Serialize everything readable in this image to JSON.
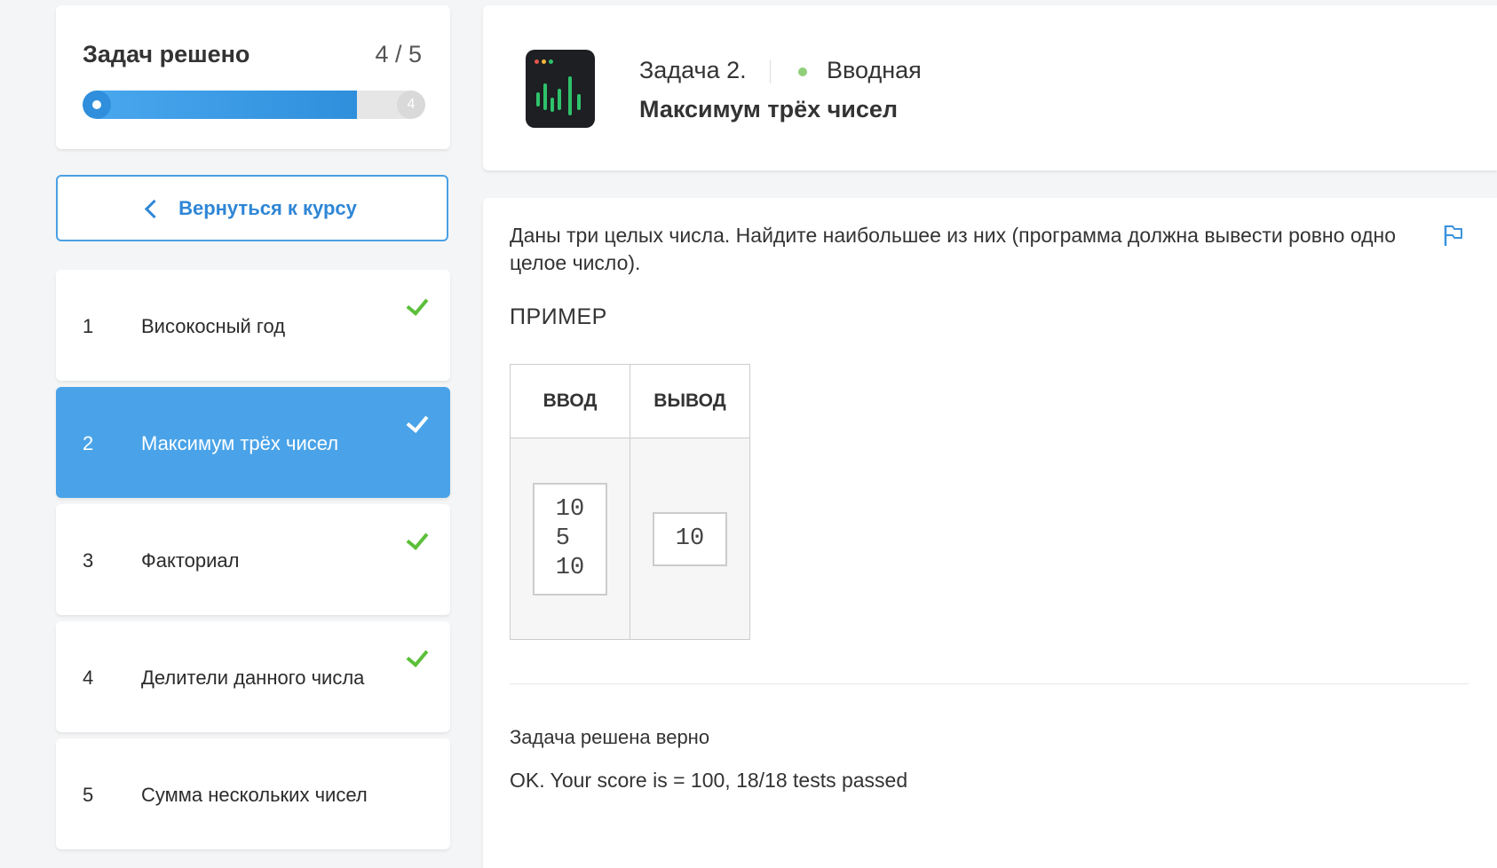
{
  "progress": {
    "title": "Задач решено",
    "count": "4 / 5",
    "solved": 4,
    "total": 5,
    "end_marker": "4"
  },
  "back_button": {
    "label": "Вернуться к курсу"
  },
  "tasks": [
    {
      "num": "1",
      "label": "Високосный год",
      "solved": true,
      "active": false
    },
    {
      "num": "2",
      "label": "Максимум трёх чисел",
      "solved": true,
      "active": true
    },
    {
      "num": "3",
      "label": "Факториал",
      "solved": true,
      "active": false
    },
    {
      "num": "4",
      "label": "Делители данного числа",
      "solved": true,
      "active": false
    },
    {
      "num": "5",
      "label": "Сумма нескольких чисел",
      "solved": false,
      "active": false
    }
  ],
  "header": {
    "task_number": "Задача 2.",
    "level": "Вводная",
    "title": "Максимум трёх чисел",
    "icon": "terminal-chart-icon"
  },
  "content": {
    "statement": "Даны три целых числа. Найдите наибольшее из них (программа должна вывести ровно одно целое число).",
    "example_heading": "ПРИМЕР",
    "table": {
      "input_header": "ВВОД",
      "output_header": "ВЫВОД",
      "input_value": "10\n5\n10",
      "output_value": "10"
    },
    "result_status": "Задача решена верно",
    "result_details": "OK. Your score is = 100, 18/18 tests passed"
  },
  "colors": {
    "accent": "#4aa3e8",
    "progress": "#2f8fdc",
    "check": "#5cbf3a",
    "level_dot": "#8fcf7a"
  }
}
